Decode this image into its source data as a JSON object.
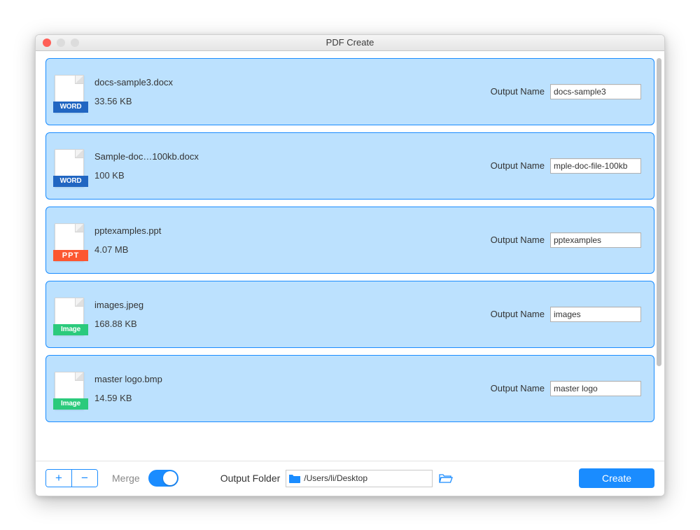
{
  "window": {
    "title": "PDF Create"
  },
  "output_name_label": "Output Name",
  "files": [
    {
      "name": "docs-sample3.docx",
      "size": "33.56 KB",
      "output": "docs-sample3",
      "kind": "word",
      "badge": "WORD"
    },
    {
      "name": "Sample-doc…100kb.docx",
      "size": "100 KB",
      "output": "mple-doc-file-100kb",
      "kind": "word",
      "badge": "WORD"
    },
    {
      "name": "pptexamples.ppt",
      "size": "4.07 MB",
      "output": "pptexamples",
      "kind": "ppt",
      "badge": "PPT"
    },
    {
      "name": "images.jpeg",
      "size": "168.88 KB",
      "output": "images",
      "kind": "image",
      "badge": "Image"
    },
    {
      "name": "master logo.bmp",
      "size": "14.59 KB",
      "output": "master logo",
      "kind": "image",
      "badge": "Image"
    }
  ],
  "footer": {
    "merge_label": "Merge",
    "output_folder_label": "Output Folder",
    "output_folder_path": "/Users/li/Desktop",
    "create_label": "Create"
  }
}
